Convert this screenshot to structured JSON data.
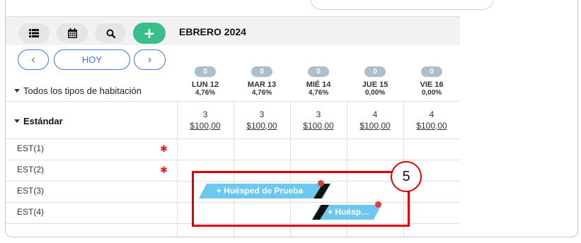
{
  "calendar": {
    "month_label": "EBRERO 2024",
    "room_type_filter": "Todos los tipos de habitación",
    "nav": {
      "prev": "‹",
      "today": "HOY",
      "next": "›"
    },
    "toolbar": {
      "add": "+"
    },
    "days": [
      {
        "badge": "0",
        "label": "LUN 12",
        "pct": "4,76%"
      },
      {
        "badge": "0",
        "label": "MAR 13",
        "pct": "4,76%"
      },
      {
        "badge": "0",
        "label": "MIÉ 14",
        "pct": "4,76%"
      },
      {
        "badge": "0",
        "label": "JUE 15",
        "pct": "0,00%"
      },
      {
        "badge": "0",
        "label": "VIE 16",
        "pct": "0,00%"
      }
    ],
    "category": {
      "name": "Estándar",
      "availability": [
        {
          "count": "3",
          "price": "$100,00"
        },
        {
          "count": "3",
          "price": "$100,00"
        },
        {
          "count": "3",
          "price": "$100,00"
        },
        {
          "count": "4",
          "price": "$100,00"
        },
        {
          "count": "4",
          "price": "$100,00"
        }
      ]
    },
    "rooms": [
      {
        "name": "EST(1)",
        "flag": "✱"
      },
      {
        "name": "EST(2)",
        "flag": "✱"
      },
      {
        "name": "EST(3)",
        "flag": ""
      },
      {
        "name": "EST(4)",
        "flag": ""
      }
    ],
    "bookings": [
      {
        "label": "+ Huésped de Prueba"
      },
      {
        "label": "+ Huésped de Prueba"
      }
    ]
  },
  "annotation": {
    "step_number": "5",
    "color": "#e00000"
  },
  "colors": {
    "accent_green": "#3bbf8a",
    "accent_blue": "#3f78e0",
    "booking": "#6cc8ef",
    "badge": "#aebfcb"
  }
}
